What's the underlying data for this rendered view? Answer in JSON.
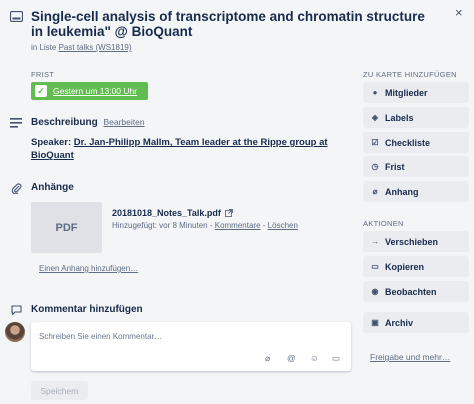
{
  "card": {
    "title": "Single-cell analysis of transcriptome and chromatin structure in leukemia\" @ BioQuant",
    "list_prefix": "in Liste",
    "list_name": "Past talks (WS1819)",
    "close_icon": "×"
  },
  "due": {
    "label": "Frist",
    "value": "Gestern um 13:00 Uhr",
    "checked": true,
    "color": "#61bd4f"
  },
  "description": {
    "heading": "Beschreibung",
    "edit_label": "Bearbeiten",
    "speaker_prefix": "Speaker:",
    "speaker_link": "Dr. Jan-Philipp Mallm, Team leader at the Rippe group at BioQuant"
  },
  "attachments": {
    "heading": "Anhänge",
    "items": [
      {
        "thumb_label": "PDF",
        "name": "20181018_Notes_Talk.pdf",
        "meta_prefix": "Hinzugefügt: vor 8 Minuten -",
        "comment_label": "Kommentare",
        "delete_label": "Löschen"
      }
    ],
    "add_label": "Einen Anhang hinzufügen…"
  },
  "comment": {
    "heading": "Kommentar hinzufügen",
    "placeholder": "Schreiben Sie einen Kommentar…",
    "save_label": "Speichern"
  },
  "sidebar": {
    "add_heading": "Zu Karte hinzufügen",
    "add_items": [
      {
        "icon": "person-icon",
        "label": "Mitglieder"
      },
      {
        "icon": "label-icon",
        "label": "Labels"
      },
      {
        "icon": "checklist-icon",
        "label": "Checkliste"
      },
      {
        "icon": "clock-icon",
        "label": "Frist"
      },
      {
        "icon": "paperclip-icon",
        "label": "Anhang"
      }
    ],
    "actions_heading": "Aktionen",
    "action_items": [
      {
        "icon": "arrow-right-icon",
        "label": "Verschieben"
      },
      {
        "icon": "copy-icon",
        "label": "Kopieren"
      },
      {
        "icon": "eye-icon",
        "label": "Beobachten"
      },
      {
        "icon": "archive-icon",
        "label": "Archiv"
      }
    ],
    "share_label": "Freigabe und mehr…"
  }
}
